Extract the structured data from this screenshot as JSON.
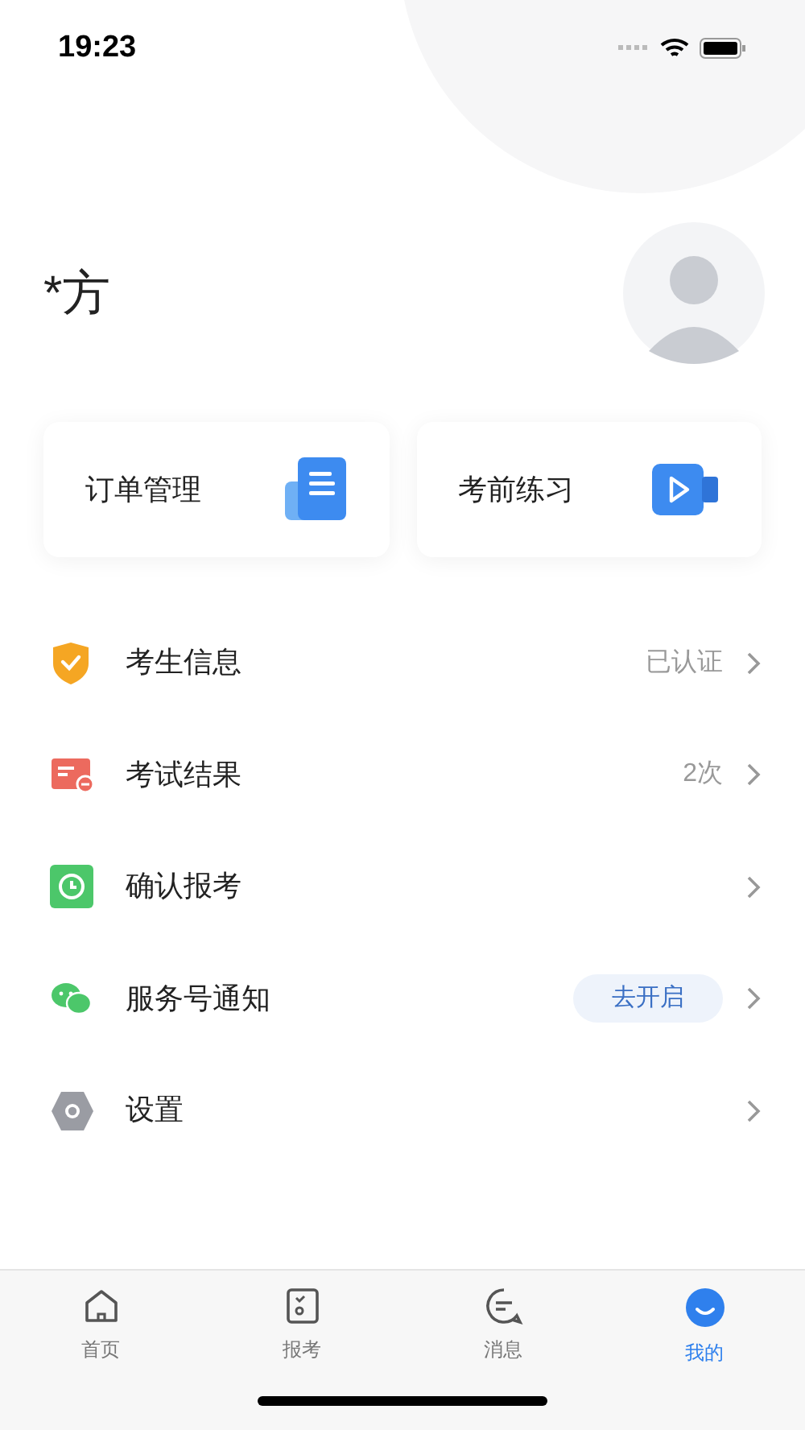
{
  "status_bar": {
    "time": "19:23"
  },
  "profile": {
    "name": "*方"
  },
  "cards": [
    {
      "label": "订单管理",
      "kind": "document"
    },
    {
      "label": "考前练习",
      "kind": "video"
    }
  ],
  "menu": [
    {
      "label": "考生信息",
      "kind": "text",
      "value": "已认证"
    },
    {
      "label": "考试结果",
      "kind": "text",
      "value": "2次"
    },
    {
      "label": "确认报考",
      "kind": "plain"
    },
    {
      "label": "服务号通知",
      "kind": "badge",
      "value": "去开启"
    },
    {
      "label": "设置",
      "kind": "plain"
    }
  ],
  "tab_bar": [
    {
      "label": "首页",
      "selected": false
    },
    {
      "label": "报考",
      "selected": false
    },
    {
      "label": "消息",
      "selected": false
    },
    {
      "label": "我的",
      "selected": true
    }
  ]
}
